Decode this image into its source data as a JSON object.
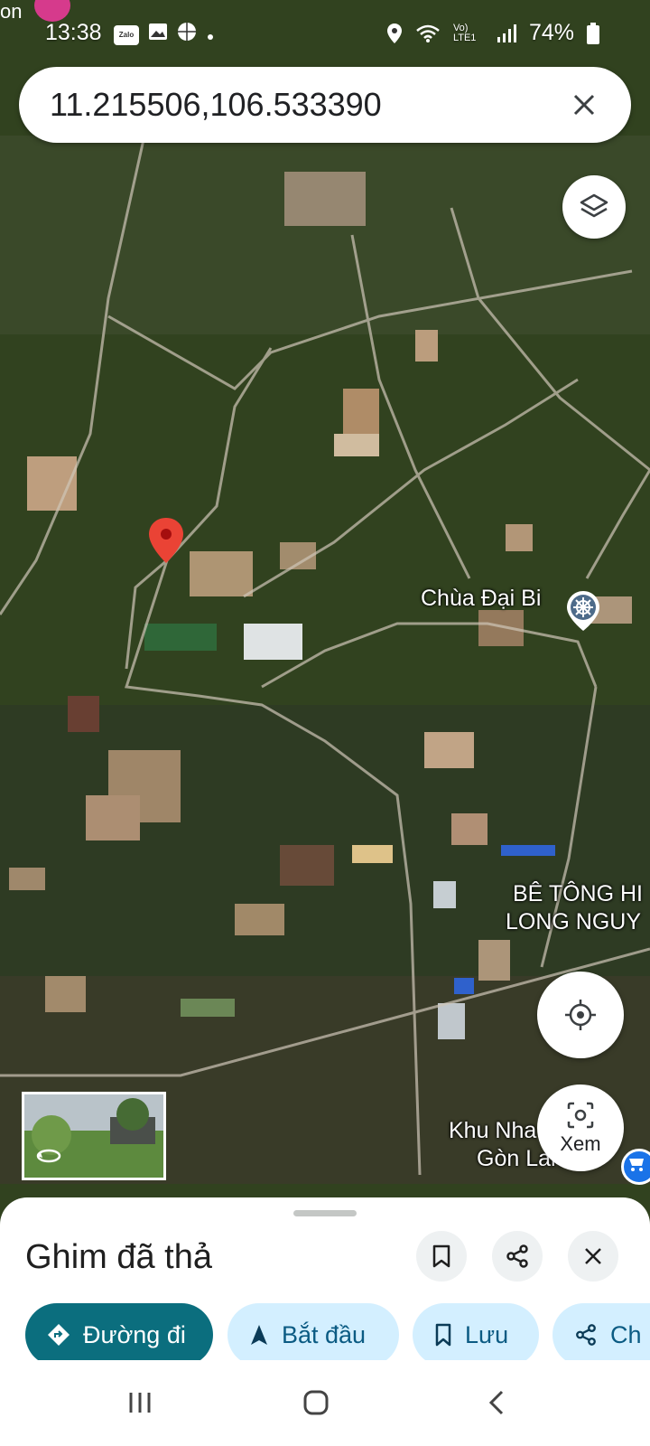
{
  "status": {
    "time": "13:38",
    "left_clip": "on",
    "notif_icons": [
      "zalo-icon",
      "image-icon",
      "basketball-icon",
      "dot-icon"
    ],
    "zalo_label": "Zalo",
    "network": "Vo) LTE1",
    "battery": "74%"
  },
  "search": {
    "value": "11.215506,106.533390"
  },
  "map": {
    "labels": {
      "poi": "Chùa Đại Bi",
      "company_line1": "BÊ TÔNG HI",
      "company_line2": "LONG NGUY",
      "area_line1": "Khu Nha",
      "area_line2": "Gòn Land 2"
    }
  },
  "lens": {
    "label": "Xem"
  },
  "sheet": {
    "title": "Ghim đã thả",
    "chips": {
      "directions": "Đường đi",
      "start": "Bắt đầu",
      "save": "Lưu",
      "share": "Ch"
    }
  },
  "colors": {
    "accent": "#0b6e7e",
    "chip_bg": "#d3efff",
    "pin": "#ea4335"
  }
}
